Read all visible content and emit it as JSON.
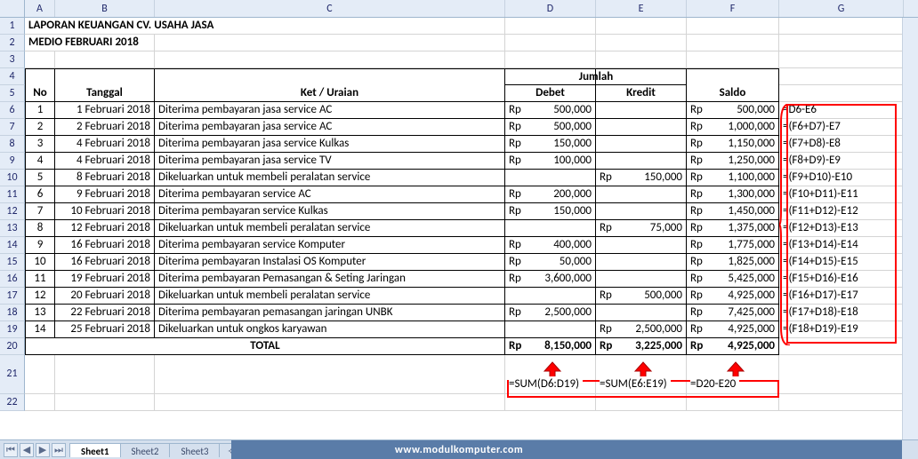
{
  "columns": [
    "A",
    "B",
    "C",
    "D",
    "E",
    "F",
    "G"
  ],
  "title": "LAPORAN KEUANGAN CV. USAHA JASA",
  "subtitle": "MEDIO FEBRUARI 2018",
  "headers": {
    "no": "No",
    "tanggal": "Tanggal",
    "ket": "Ket / Uraian",
    "jumlah": "Jumlah",
    "debet": "Debet",
    "kredit": "Kredit",
    "saldo": "Saldo"
  },
  "currency": "Rp",
  "rows": [
    {
      "no": "1",
      "tgl": "1 Februari 2018",
      "ket": "Diterima pembayaran jasa service AC",
      "debet": "500,000",
      "kredit": "",
      "saldo": "500,000",
      "f": "=D6-E6"
    },
    {
      "no": "2",
      "tgl": "2 Februari 2018",
      "ket": "Diterima pembayaran jasa service AC",
      "debet": "500,000",
      "kredit": "",
      "saldo": "1,000,000",
      "f": "=(F6+D7)-E7"
    },
    {
      "no": "3",
      "tgl": "4 Februari 2018",
      "ket": "Diterima pembayaran jasa service Kulkas",
      "debet": "150,000",
      "kredit": "",
      "saldo": "1,150,000",
      "f": "=(F7+D8)-E8"
    },
    {
      "no": "4",
      "tgl": "4 Februari 2018",
      "ket": "Diterima pembayaran jasa service TV",
      "debet": "100,000",
      "kredit": "",
      "saldo": "1,250,000",
      "f": "=(F8+D9)-E9"
    },
    {
      "no": "5",
      "tgl": "8 Februari 2018",
      "ket": "Dikeluarkan untuk membeli peralatan service",
      "debet": "",
      "kredit": "150,000",
      "saldo": "1,100,000",
      "f": "=(F9+D10)-E10"
    },
    {
      "no": "6",
      "tgl": "9 Februari 2018",
      "ket": "Diterima pembayaran service AC",
      "debet": "200,000",
      "kredit": "",
      "saldo": "1,300,000",
      "f": "=(F10+D11)-E11"
    },
    {
      "no": "7",
      "tgl": "10 Februari 2018",
      "ket": "Diterima pembayaran service Kulkas",
      "debet": "150,000",
      "kredit": "",
      "saldo": "1,450,000",
      "f": "=(F11+D12)-E12"
    },
    {
      "no": "8",
      "tgl": "12 Februari 2018",
      "ket": "Dikeluarkan untuk membeli peralatan service",
      "debet": "",
      "kredit": "75,000",
      "saldo": "1,375,000",
      "f": "=(F12+D13)-E13"
    },
    {
      "no": "9",
      "tgl": "16 Februari 2018",
      "ket": "Diterima pembayaran service Komputer",
      "debet": "400,000",
      "kredit": "",
      "saldo": "1,775,000",
      "f": "=(F13+D14)-E14"
    },
    {
      "no": "10",
      "tgl": "16 Februari 2018",
      "ket": "Diterima pembayaran Instalasi OS Komputer",
      "debet": "50,000",
      "kredit": "",
      "saldo": "1,825,000",
      "f": "=(F14+D15)-E15"
    },
    {
      "no": "11",
      "tgl": "19 Februari 2018",
      "ket": "Diterima pembayaran Pemasangan & Seting Jaringan",
      "debet": "3,600,000",
      "kredit": "",
      "saldo": "5,425,000",
      "f": "=(F15+D16)-E16"
    },
    {
      "no": "12",
      "tgl": "20 Februari 2018",
      "ket": "Dikeluarkan untuk membeli peralatan service",
      "debet": "",
      "kredit": "500,000",
      "saldo": "4,925,000",
      "f": "=(F16+D17)-E17"
    },
    {
      "no": "13",
      "tgl": "22 Februari 2018",
      "ket": "Diterima pembayaran pemasangan jaringan UNBK",
      "debet": "2,500,000",
      "kredit": "",
      "saldo": "7,425,000",
      "f": "=(F17+D18)-E18"
    },
    {
      "no": "14",
      "tgl": "25 Februari 2018",
      "ket": "Dikeluarkan untuk ongkos karyawan",
      "debet": "",
      "kredit": "2,500,000",
      "saldo": "4,925,000",
      "f": "=(F18+D19)-E19"
    }
  ],
  "total": {
    "label": "TOTAL",
    "debet": "8,150,000",
    "kredit": "3,225,000",
    "saldo": "4,925,000"
  },
  "sum_formulas": {
    "d": "=SUM(D6:D19)",
    "e": "=SUM(E6:E19)",
    "f": "=D20-E20"
  },
  "tabs": [
    "Sheet1",
    "Sheet2",
    "Sheet3"
  ],
  "watermark": "www.modulkomputer.com",
  "nav": {
    "first": "⏮",
    "prev": "◀",
    "next": "▶",
    "last": "⏭"
  },
  "chart_data": {
    "type": "table",
    "title": "LAPORAN KEUANGAN CV. USAHA JASA — MEDIO FEBRUARI 2018",
    "columns": [
      "No",
      "Tanggal",
      "Ket / Uraian",
      "Debet",
      "Kredit",
      "Saldo"
    ],
    "rows": [
      [
        1,
        "1 Februari 2018",
        "Diterima pembayaran jasa service AC",
        500000,
        null,
        500000
      ],
      [
        2,
        "2 Februari 2018",
        "Diterima pembayaran jasa service AC",
        500000,
        null,
        1000000
      ],
      [
        3,
        "4 Februari 2018",
        "Diterima pembayaran jasa service Kulkas",
        150000,
        null,
        1150000
      ],
      [
        4,
        "4 Februari 2018",
        "Diterima pembayaran jasa service TV",
        100000,
        null,
        1250000
      ],
      [
        5,
        "8 Februari 2018",
        "Dikeluarkan untuk membeli peralatan service",
        null,
        150000,
        1100000
      ],
      [
        6,
        "9 Februari 2018",
        "Diterima pembayaran service AC",
        200000,
        null,
        1300000
      ],
      [
        7,
        "10 Februari 2018",
        "Diterima pembayaran service Kulkas",
        150000,
        null,
        1450000
      ],
      [
        8,
        "12 Februari 2018",
        "Dikeluarkan untuk membeli peralatan service",
        null,
        75000,
        1375000
      ],
      [
        9,
        "16 Februari 2018",
        "Diterima pembayaran service Komputer",
        400000,
        null,
        1775000
      ],
      [
        10,
        "16 Februari 2018",
        "Diterima pembayaran Instalasi OS Komputer",
        50000,
        null,
        1825000
      ],
      [
        11,
        "19 Februari 2018",
        "Diterima pembayaran Pemasangan & Seting Jaringan",
        3600000,
        null,
        5425000
      ],
      [
        12,
        "20 Februari 2018",
        "Dikeluarkan untuk membeli peralatan service",
        null,
        500000,
        4925000
      ],
      [
        13,
        "22 Februari 2018",
        "Diterima pembayaran pemasangan jaringan UNBK",
        2500000,
        null,
        7425000
      ],
      [
        14,
        "25 Februari 2018",
        "Dikeluarkan untuk ongkos karyawan",
        null,
        2500000,
        4925000
      ]
    ],
    "totals": {
      "Debet": 8150000,
      "Kredit": 3225000,
      "Saldo": 4925000
    }
  }
}
